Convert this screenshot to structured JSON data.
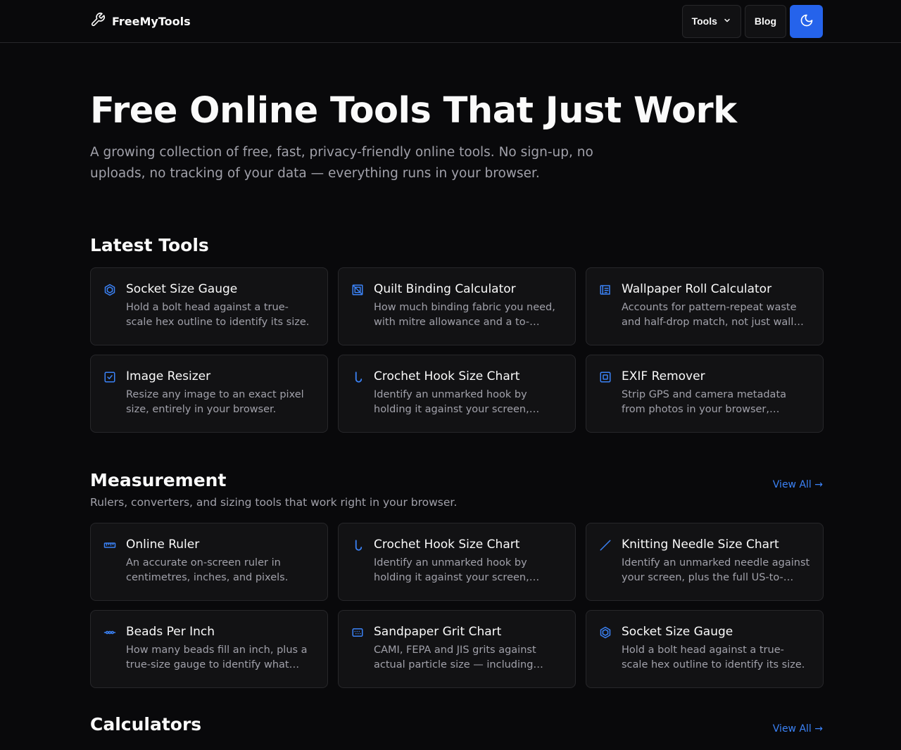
{
  "header": {
    "logo_text": "FreeMyTools",
    "nav": {
      "tools_label": "Tools",
      "blog_label": "Blog"
    }
  },
  "hero": {
    "title": "Free Online Tools That Just Work",
    "subtitle": "A growing collection of free, fast, privacy-friendly online tools. No sign-up, no uploads, no tracking of your data — everything runs in your browser."
  },
  "latest": {
    "title": "Latest Tools",
    "cards": [
      {
        "icon": "hexagon-icon",
        "title": "Socket Size Gauge",
        "desc": "Hold a bolt head against a true-scale hex outline to identify its size."
      },
      {
        "icon": "quilt-icon",
        "title": "Quilt Binding Calculator",
        "desc": "How much binding fabric you need, with mitre allowance and a to-scale…"
      },
      {
        "icon": "wallpaper-icon",
        "title": "Wallpaper Roll Calculator",
        "desc": "Accounts for pattern-repeat waste and half-drop match, not just wall…"
      },
      {
        "icon": "checkbox-icon",
        "title": "Image Resizer",
        "desc": "Resize any image to an exact pixel size, entirely in your browser."
      },
      {
        "icon": "hook-icon",
        "title": "Crochet Hook Size Chart",
        "desc": "Identify an unmarked hook by holding it against your screen, plus…"
      },
      {
        "icon": "exif-icon",
        "title": "EXIF Remover",
        "desc": "Strip GPS and camera metadata from photos in your browser, without re-…"
      }
    ]
  },
  "measurement": {
    "title": "Measurement",
    "view_all": "View All →",
    "description": "Rulers, converters, and sizing tools that work right in your browser.",
    "cards": [
      {
        "icon": "ruler-icon",
        "title": "Online Ruler",
        "desc": "An accurate on-screen ruler in centimetres, inches, and pixels."
      },
      {
        "icon": "hook-icon",
        "title": "Crochet Hook Size Chart",
        "desc": "Identify an unmarked hook by holding it against your screen, plus…"
      },
      {
        "icon": "needle-icon",
        "title": "Knitting Needle Size Chart",
        "desc": "Identify an unmarked needle against your screen, plus the full US-to-mm…"
      },
      {
        "icon": "beads-icon",
        "title": "Beads Per Inch",
        "desc": "How many beads fill an inch, plus a true-size gauge to identify what you…"
      },
      {
        "icon": "sandpaper-icon",
        "title": "Sandpaper Grit Chart",
        "desc": "CAMI, FEPA and JIS grits against actual particle size — including wher…"
      },
      {
        "icon": "hexagon-icon",
        "title": "Socket Size Gauge",
        "desc": "Hold a bolt head against a true-scale hex outline to identify its size."
      }
    ]
  },
  "calculators": {
    "title": "Calculators",
    "view_all": "View All →"
  },
  "colors": {
    "background": "#09090b",
    "card": "#121214",
    "border": "#27272a",
    "accent": "#2563eb",
    "link": "#3b82f6",
    "muted": "#a1a1aa"
  }
}
